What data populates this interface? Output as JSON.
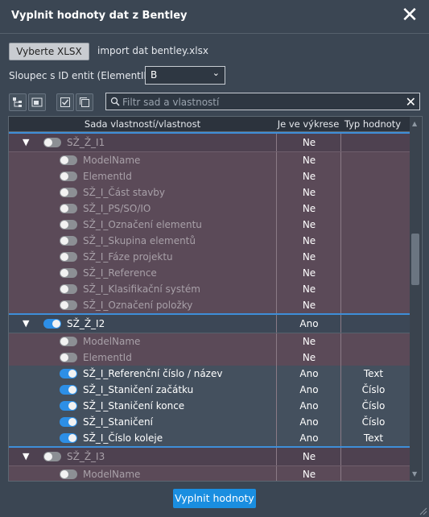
{
  "window": {
    "title": "Vyplnit hodnoty dat z Bentley"
  },
  "file": {
    "button_label": "Vyberte XLSX",
    "filename": "import dat bentley.xlsx"
  },
  "id_column": {
    "label": "Sloupec s ID entit (ElementID):",
    "selected": "B"
  },
  "filter": {
    "placeholder": "Filtr sad a vlastností",
    "value": ""
  },
  "table": {
    "headers": [
      "Sada vlastností/vlastnost",
      "Je ve výkrese",
      "Typ hodnoty"
    ],
    "rows": [
      {
        "kind": "group",
        "name": "SŽ_Ž_I1",
        "on": false,
        "in_drawing": "Ne",
        "type": ""
      },
      {
        "kind": "prop",
        "name": "ModelName",
        "on": false,
        "in_drawing": "Ne",
        "type": ""
      },
      {
        "kind": "prop",
        "name": "ElementId",
        "on": false,
        "in_drawing": "Ne",
        "type": ""
      },
      {
        "kind": "prop",
        "name": "SŽ_I_Část stavby",
        "on": false,
        "in_drawing": "Ne",
        "type": ""
      },
      {
        "kind": "prop",
        "name": "SŽ_I_PS/SO/IO",
        "on": false,
        "in_drawing": "Ne",
        "type": ""
      },
      {
        "kind": "prop",
        "name": "SŽ_I_Označení elementu",
        "on": false,
        "in_drawing": "Ne",
        "type": ""
      },
      {
        "kind": "prop",
        "name": "SŽ_I_Skupina elementů",
        "on": false,
        "in_drawing": "Ne",
        "type": ""
      },
      {
        "kind": "prop",
        "name": "SŽ_I_Fáze projektu",
        "on": false,
        "in_drawing": "Ne",
        "type": ""
      },
      {
        "kind": "prop",
        "name": "SŽ_I_Reference",
        "on": false,
        "in_drawing": "Ne",
        "type": ""
      },
      {
        "kind": "prop",
        "name": "SŽ_I_Klasifikační systém",
        "on": false,
        "in_drawing": "Ne",
        "type": ""
      },
      {
        "kind": "prop",
        "name": "SŽ_I_Označení položky",
        "on": false,
        "in_drawing": "Ne",
        "type": ""
      },
      {
        "kind": "group",
        "name": "SŽ_Ž_I2",
        "on": true,
        "in_drawing": "Ano",
        "type": ""
      },
      {
        "kind": "prop",
        "name": "ModelName",
        "on": false,
        "in_drawing": "Ne",
        "type": ""
      },
      {
        "kind": "prop",
        "name": "ElementId",
        "on": false,
        "in_drawing": "Ne",
        "type": ""
      },
      {
        "kind": "prop",
        "name": "SŽ_I_Referenční číslo / název",
        "on": true,
        "in_drawing": "Ano",
        "type": "Text"
      },
      {
        "kind": "prop",
        "name": "SŽ_I_Staničení začátku",
        "on": true,
        "in_drawing": "Ano",
        "type": "Číslo"
      },
      {
        "kind": "prop",
        "name": "SŽ_I_Staničení konce",
        "on": true,
        "in_drawing": "Ano",
        "type": "Číslo"
      },
      {
        "kind": "prop",
        "name": "SŽ_I_Staničení",
        "on": true,
        "in_drawing": "Ano",
        "type": "Číslo"
      },
      {
        "kind": "prop",
        "name": "SŽ_I_Číslo koleje",
        "on": true,
        "in_drawing": "Ano",
        "type": "Text"
      },
      {
        "kind": "group",
        "name": "SŽ_Ž_I3",
        "on": false,
        "in_drawing": "Ne",
        "type": ""
      },
      {
        "kind": "prop",
        "name": "ModelName",
        "on": false,
        "in_drawing": "Ne",
        "type": ""
      }
    ]
  },
  "actions": {
    "submit_label": "Vyplnit hodnoty"
  },
  "colors": {
    "accent": "#2d8fe6",
    "inactive_row": "#5b4a58",
    "active_row": "#44505e",
    "button": "#1a8ee0"
  }
}
